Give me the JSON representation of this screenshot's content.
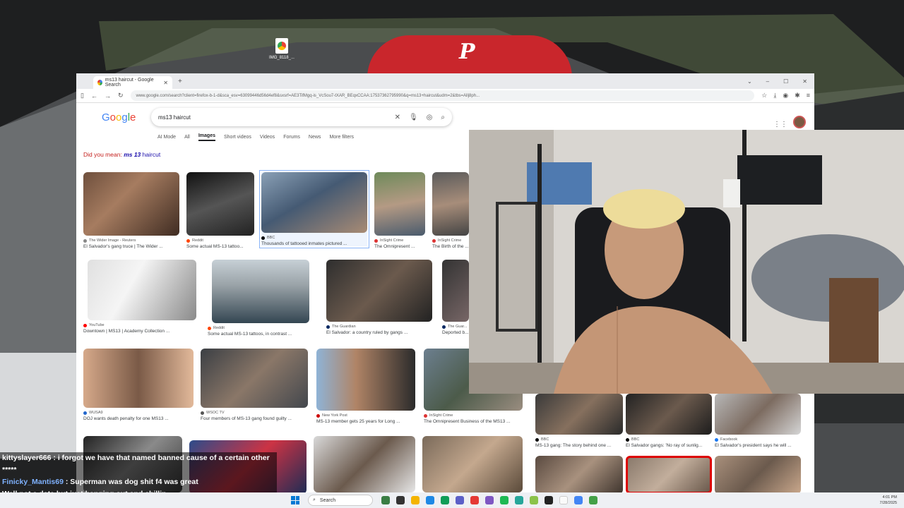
{
  "desktop": {
    "file_label": "IMG_8118_..."
  },
  "browser": {
    "tab_title": "ms13 haircut - Google Search",
    "url": "www.google.com/search?client=firefox-b-1-d&sca_esv=63099446d56d4ef8&sxsrf=AE3TifMgq-is_VcSou7-tXAR_BEqxCCAA:17537362795990&q=ms13+haircut&udm=2&tbs=Allj8ph...",
    "search_query": "ms13 haircut",
    "tabs": [
      "AI Mode",
      "All",
      "Images",
      "Short videos",
      "Videos",
      "Forums",
      "News",
      "More filters"
    ],
    "active_tab": "Images",
    "did_you_mean_label": "Did you mean:",
    "did_you_mean_bold": "ms 13",
    "did_you_mean_rest": "haircut",
    "results": [
      {
        "source": "The Wider Image - Reuters",
        "caption": "El Salvador's gang truce | The Wider ..."
      },
      {
        "source": "Reddit",
        "caption": "Some actual MS-13 tattoo..."
      },
      {
        "source": "BBC",
        "caption": "Thousands of tattooed inmates pictured ..."
      },
      {
        "source": "InSight Crime",
        "caption": "The Omnipresent ..."
      },
      {
        "source": "InSight Crime",
        "caption": "The Birth of the ..."
      },
      {
        "source": "YouTube",
        "caption": "Downtown | MS13 | Academy Collection ..."
      },
      {
        "source": "Reddit",
        "caption": "Some actual MS-13 tattoos, in contrast ..."
      },
      {
        "source": "The Guardian",
        "caption": "El Salvador: a country ruled by gangs ..."
      },
      {
        "source": "The Guar...",
        "caption": "Deported b..."
      },
      {
        "source": "WUSA9",
        "caption": "DOJ wants death penalty for one MS13 ..."
      },
      {
        "source": "WSOC TV",
        "caption": "Four members of MS-13 gang found guilty ..."
      },
      {
        "source": "New York Post",
        "caption": "MS-13 member gets 25 years for Long ..."
      },
      {
        "source": "InSight Crime",
        "caption": "The Omnipresent Business of the MS13 ..."
      },
      {
        "source": "BBC",
        "caption": "MS-13 gang: The story behind one ..."
      },
      {
        "source": "BBC",
        "caption": "El Salvador gangs: 'No ray of sunlig..."
      },
      {
        "source": "Facebook",
        "caption": "El Salvador's president says he will ..."
      }
    ]
  },
  "chat": [
    {
      "user": "kittyslayer666",
      "message": "i forgot we have that named banned cause of a certain other *****"
    },
    {
      "user": "Finicky_Mantis69",
      "message": "Superman was dog shit f4 was great"
    },
    {
      "user": "",
      "message": "Well not a date but just hanging out and chillin"
    }
  ],
  "taskbar": {
    "search_placeholder": "Search",
    "time": "4:01 PM",
    "date": "7/28/2025"
  },
  "colors": {
    "accent_red": "#c9262c",
    "google_blue": "#4285f4",
    "link": "#1a0dab"
  }
}
